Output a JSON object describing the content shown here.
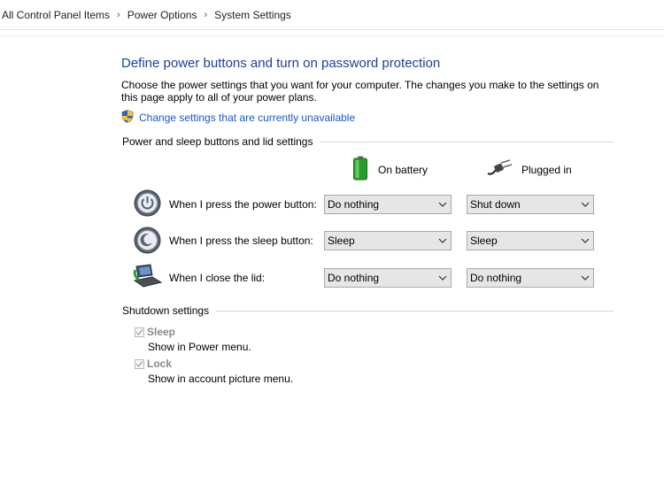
{
  "breadcrumb": {
    "items": [
      "All Control Panel Items",
      "Power Options",
      "System Settings"
    ]
  },
  "page": {
    "title": "Define power buttons and turn on password protection",
    "description": "Choose the power settings that you want for your computer. The changes you make to the settings on this page apply to all of your power plans.",
    "change_link": "Change settings that are currently unavailable"
  },
  "power_section": {
    "header": "Power and sleep buttons and lid settings",
    "col_battery": "On battery",
    "col_plugged": "Plugged in",
    "rows": [
      {
        "label": "When I press the power button:",
        "battery": "Do nothing",
        "plugged": "Shut down",
        "icon": "power-button-icon"
      },
      {
        "label": "When I press the sleep button:",
        "battery": "Sleep",
        "plugged": "Sleep",
        "icon": "sleep-button-icon"
      },
      {
        "label": "When I close the lid:",
        "battery": "Do nothing",
        "plugged": "Do nothing",
        "icon": "laptop-lid-icon"
      }
    ]
  },
  "shutdown_section": {
    "header": "Shutdown settings",
    "items": [
      {
        "title": "Sleep",
        "desc": "Show in Power menu.",
        "checked": true
      },
      {
        "title": "Lock",
        "desc": "Show in account picture menu.",
        "checked": true
      }
    ]
  },
  "colors": {
    "title_blue": "#1e3f9a",
    "link_blue": "#1a57c9",
    "dropdown_bg": "#e6e6e6"
  }
}
